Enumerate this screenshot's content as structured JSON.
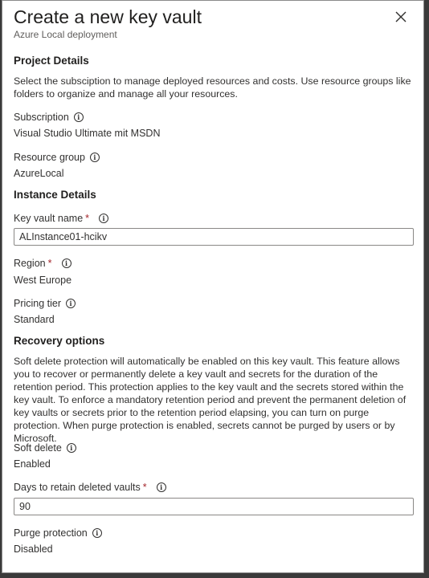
{
  "header": {
    "title": "Create a new key vault",
    "subtitle": "Azure Local deployment"
  },
  "project": {
    "heading": "Project Details",
    "description": "Select the subsciption to manage deployed resources and costs. Use resource groups like folders to organize and manage all your resources.",
    "subscription_label": "Subscription",
    "subscription_value": "Visual Studio Ultimate mit MSDN",
    "resource_group_label": "Resource group",
    "resource_group_value": "AzureLocal"
  },
  "instance": {
    "heading": "Instance Details",
    "key_vault_name_label": "Key vault name",
    "key_vault_name_value": "ALInstance01-hcikv",
    "region_label": "Region",
    "region_value": "West Europe",
    "pricing_tier_label": "Pricing tier",
    "pricing_tier_value": "Standard"
  },
  "recovery": {
    "heading": "Recovery options",
    "description": "Soft delete protection will automatically be enabled on this key vault. This feature allows you to recover or permanently delete a key vault and secrets for the duration of the retention period. This protection applies to the key vault and the secrets stored within the key vault. To enforce a mandatory retention period and prevent the permanent deletion of key vaults or secrets prior to the retention period elapsing, you can turn on purge protection. When purge protection is enabled, secrets cannot be purged by users or by Microsoft.",
    "soft_delete_label": "Soft delete",
    "soft_delete_value": "Enabled",
    "days_label": "Days to retain deleted vaults",
    "days_value": "90",
    "purge_label": "Purge protection",
    "purge_value": "Disabled"
  },
  "required_marker": "*",
  "info_glyph": "i",
  "icons": [
    "close-icon",
    "info-icon"
  ]
}
